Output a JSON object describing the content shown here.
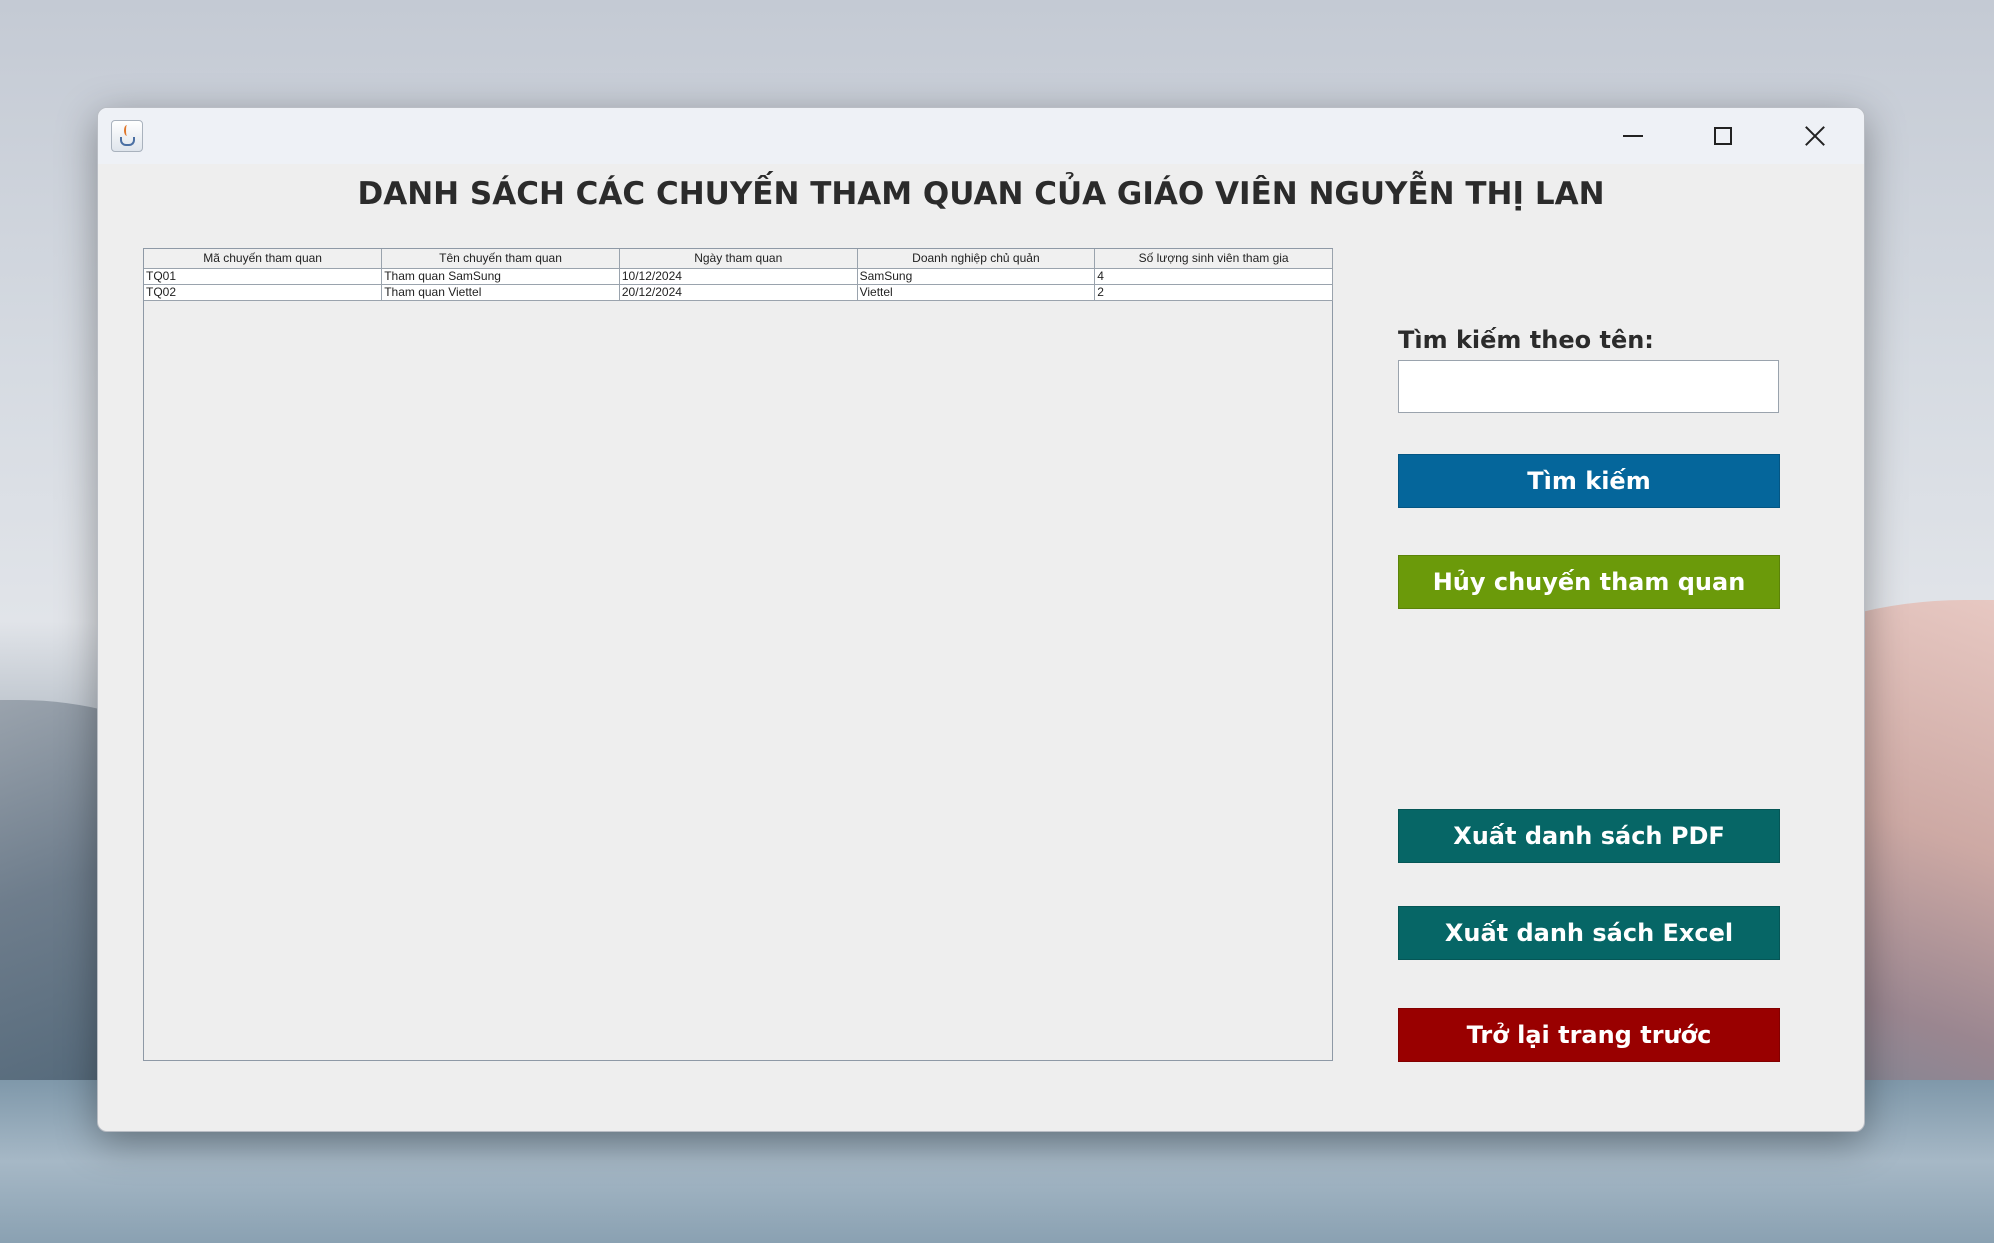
{
  "page": {
    "title": "DANH SÁCH CÁC CHUYẾN THAM QUAN CỦA GIÁO VIÊN NGUYỄN THỊ LAN"
  },
  "titlebar": {
    "icon": "java-icon",
    "minimize_icon": "minimize-icon",
    "maximize_icon": "maximize-icon",
    "close_icon": "close-icon"
  },
  "table": {
    "columns": [
      "Mã chuyến tham quan",
      "Tên chuyến tham quan",
      "Ngày tham quan",
      "Doanh nghiệp chủ quản",
      "Số lượng sinh viên tham gia"
    ],
    "rows": [
      [
        "TQ01",
        "Tham quan SamSung",
        "10/12/2024",
        "SamSung",
        "4"
      ],
      [
        "TQ02",
        "Tham quan Viettel",
        "20/12/2024",
        "Viettel",
        "2"
      ]
    ]
  },
  "search": {
    "label": "Tìm kiếm theo tên:",
    "value": "",
    "placeholder": ""
  },
  "buttons": {
    "search": "Tìm kiếm",
    "cancel_trip": "Hủy chuyến tham quan",
    "export_pdf": "Xuất danh sách PDF",
    "export_excel": "Xuất danh sách Excel",
    "back": "Trở lại trang trước"
  },
  "colors": {
    "search_button": "#05669b",
    "cancel_button": "#6b9a0a",
    "export_buttons": "#066666",
    "back_button": "#990000"
  }
}
